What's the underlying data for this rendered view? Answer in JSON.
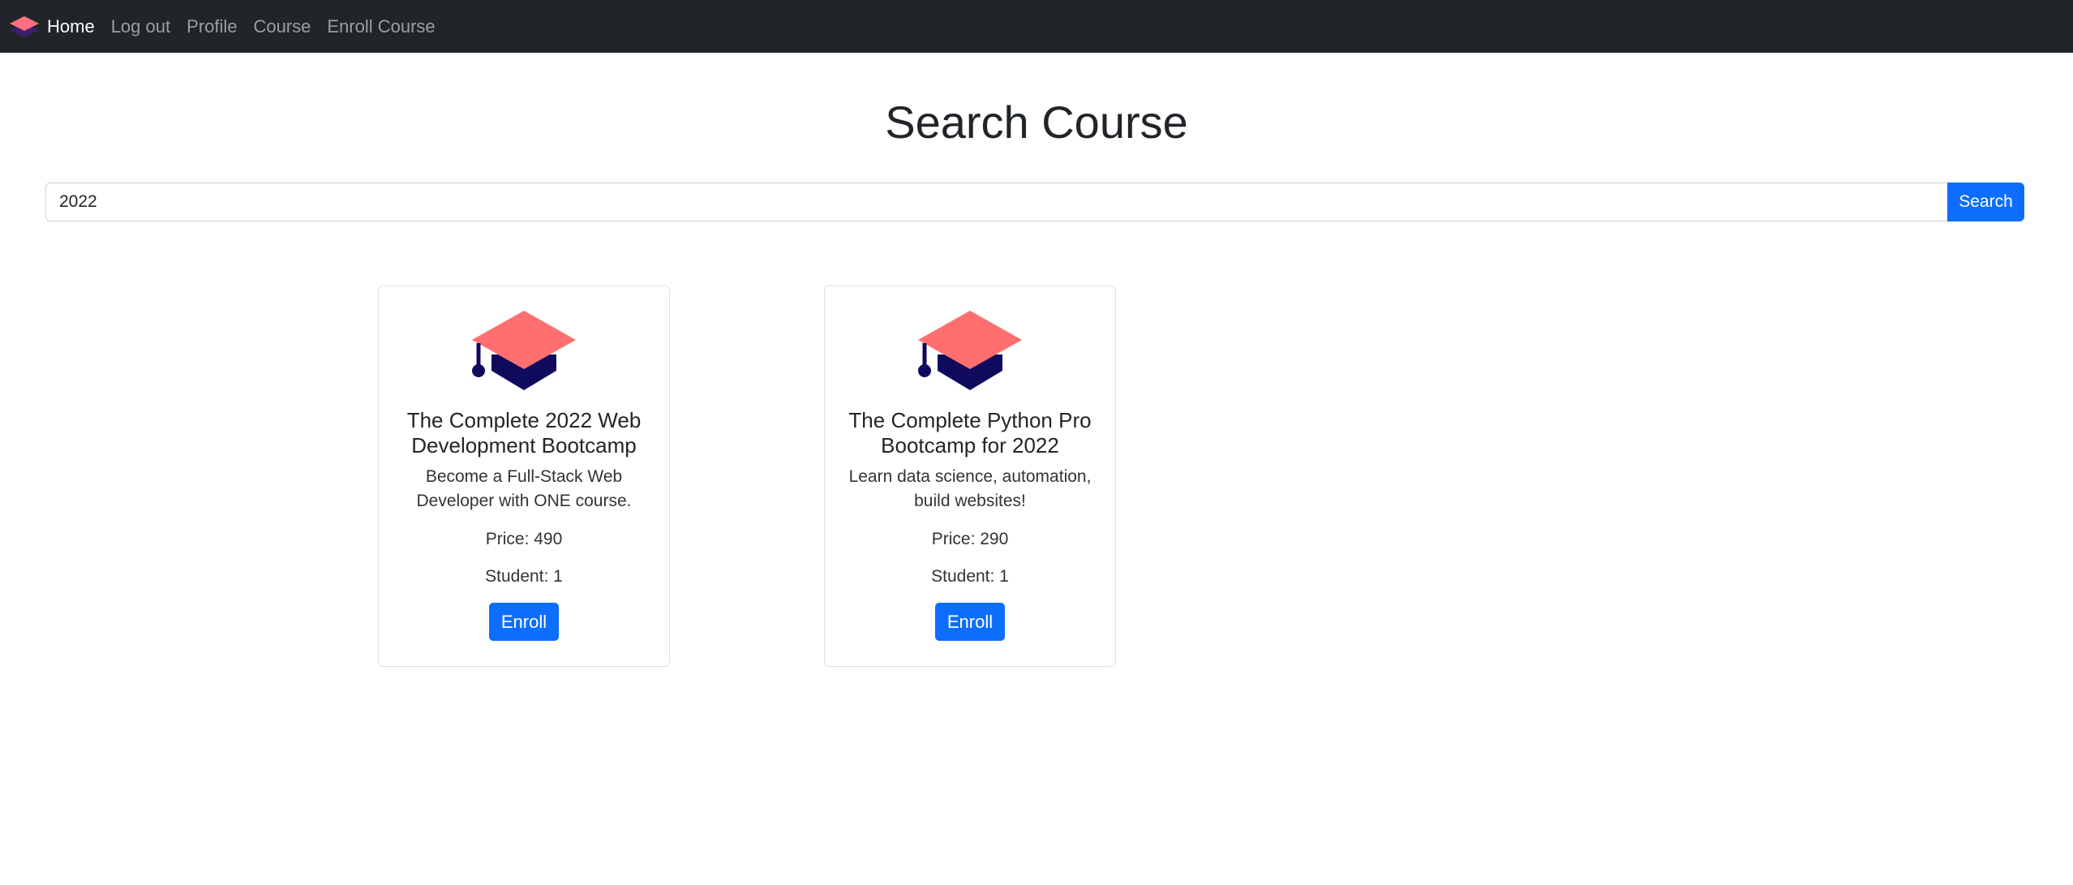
{
  "navbar": {
    "logo_icon": "stack-diamond-logo-icon",
    "links": [
      {
        "label": "Home",
        "active": true
      },
      {
        "label": "Log out",
        "active": false
      },
      {
        "label": "Profile",
        "active": false
      },
      {
        "label": "Course",
        "active": false
      },
      {
        "label": "Enroll Course",
        "active": false
      }
    ]
  },
  "page": {
    "title": "Search Course"
  },
  "search": {
    "value": "2022",
    "button_label": "Search"
  },
  "courses": [
    {
      "icon": "graduation-cap-icon",
      "title": "The Complete 2022 Web Development Bootcamp",
      "description": "Become a Full-Stack Web Developer with ONE course.",
      "price": "Price: 490",
      "students": "Student: 1",
      "button_label": "Enroll"
    },
    {
      "icon": "graduation-cap-icon",
      "title": "The Complete Python Pro Bootcamp for 2022",
      "description": "Learn data science, automation, build websites!",
      "price": "Price: 290",
      "students": "Student: 1",
      "button_label": "Enroll"
    }
  ],
  "colors": {
    "navbar_bg": "#212529",
    "primary": "#0d6efd",
    "cap_top": "#ff6f6f",
    "cap_base": "#0f0a5c"
  }
}
